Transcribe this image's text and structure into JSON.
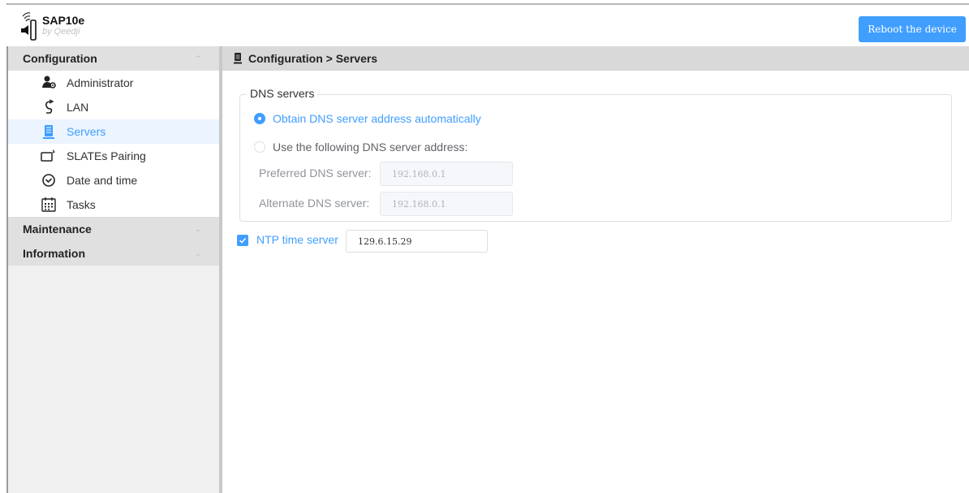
{
  "header": {
    "app_name": "SAP10e",
    "app_by": "by Qeedji",
    "reboot_label": "Reboot the device"
  },
  "sidebar": {
    "groups": [
      {
        "label": "Configuration",
        "expanded": true,
        "items": [
          {
            "label": "Administrator",
            "icon": "administrator-icon"
          },
          {
            "label": "LAN",
            "icon": "lan-icon"
          },
          {
            "label": "Servers",
            "icon": "servers-icon",
            "active": true
          },
          {
            "label": "SLATEs Pairing",
            "icon": "slates-pairing-icon"
          },
          {
            "label": "Date and time",
            "icon": "clock-icon"
          },
          {
            "label": "Tasks",
            "icon": "calendar-icon"
          }
        ]
      },
      {
        "label": "Maintenance",
        "expanded": false
      },
      {
        "label": "Information",
        "expanded": false
      }
    ]
  },
  "breadcrumb": {
    "text": "Configuration > Servers"
  },
  "dns": {
    "legend": "DNS servers",
    "auto_label": "Obtain DNS server address automatically",
    "manual_label": "Use the following DNS server address:",
    "auto_selected": true,
    "preferred_label": "Preferred DNS server:",
    "preferred_value": "192.168.0.1",
    "alternate_label": "Alternate DNS server:",
    "alternate_value": "192.168.0.1"
  },
  "ntp": {
    "label": "NTP time server",
    "checked": true,
    "value": "129.6.15.29"
  },
  "colors": {
    "accent": "#409eff",
    "active_item_bg": "#ebf4ff"
  }
}
